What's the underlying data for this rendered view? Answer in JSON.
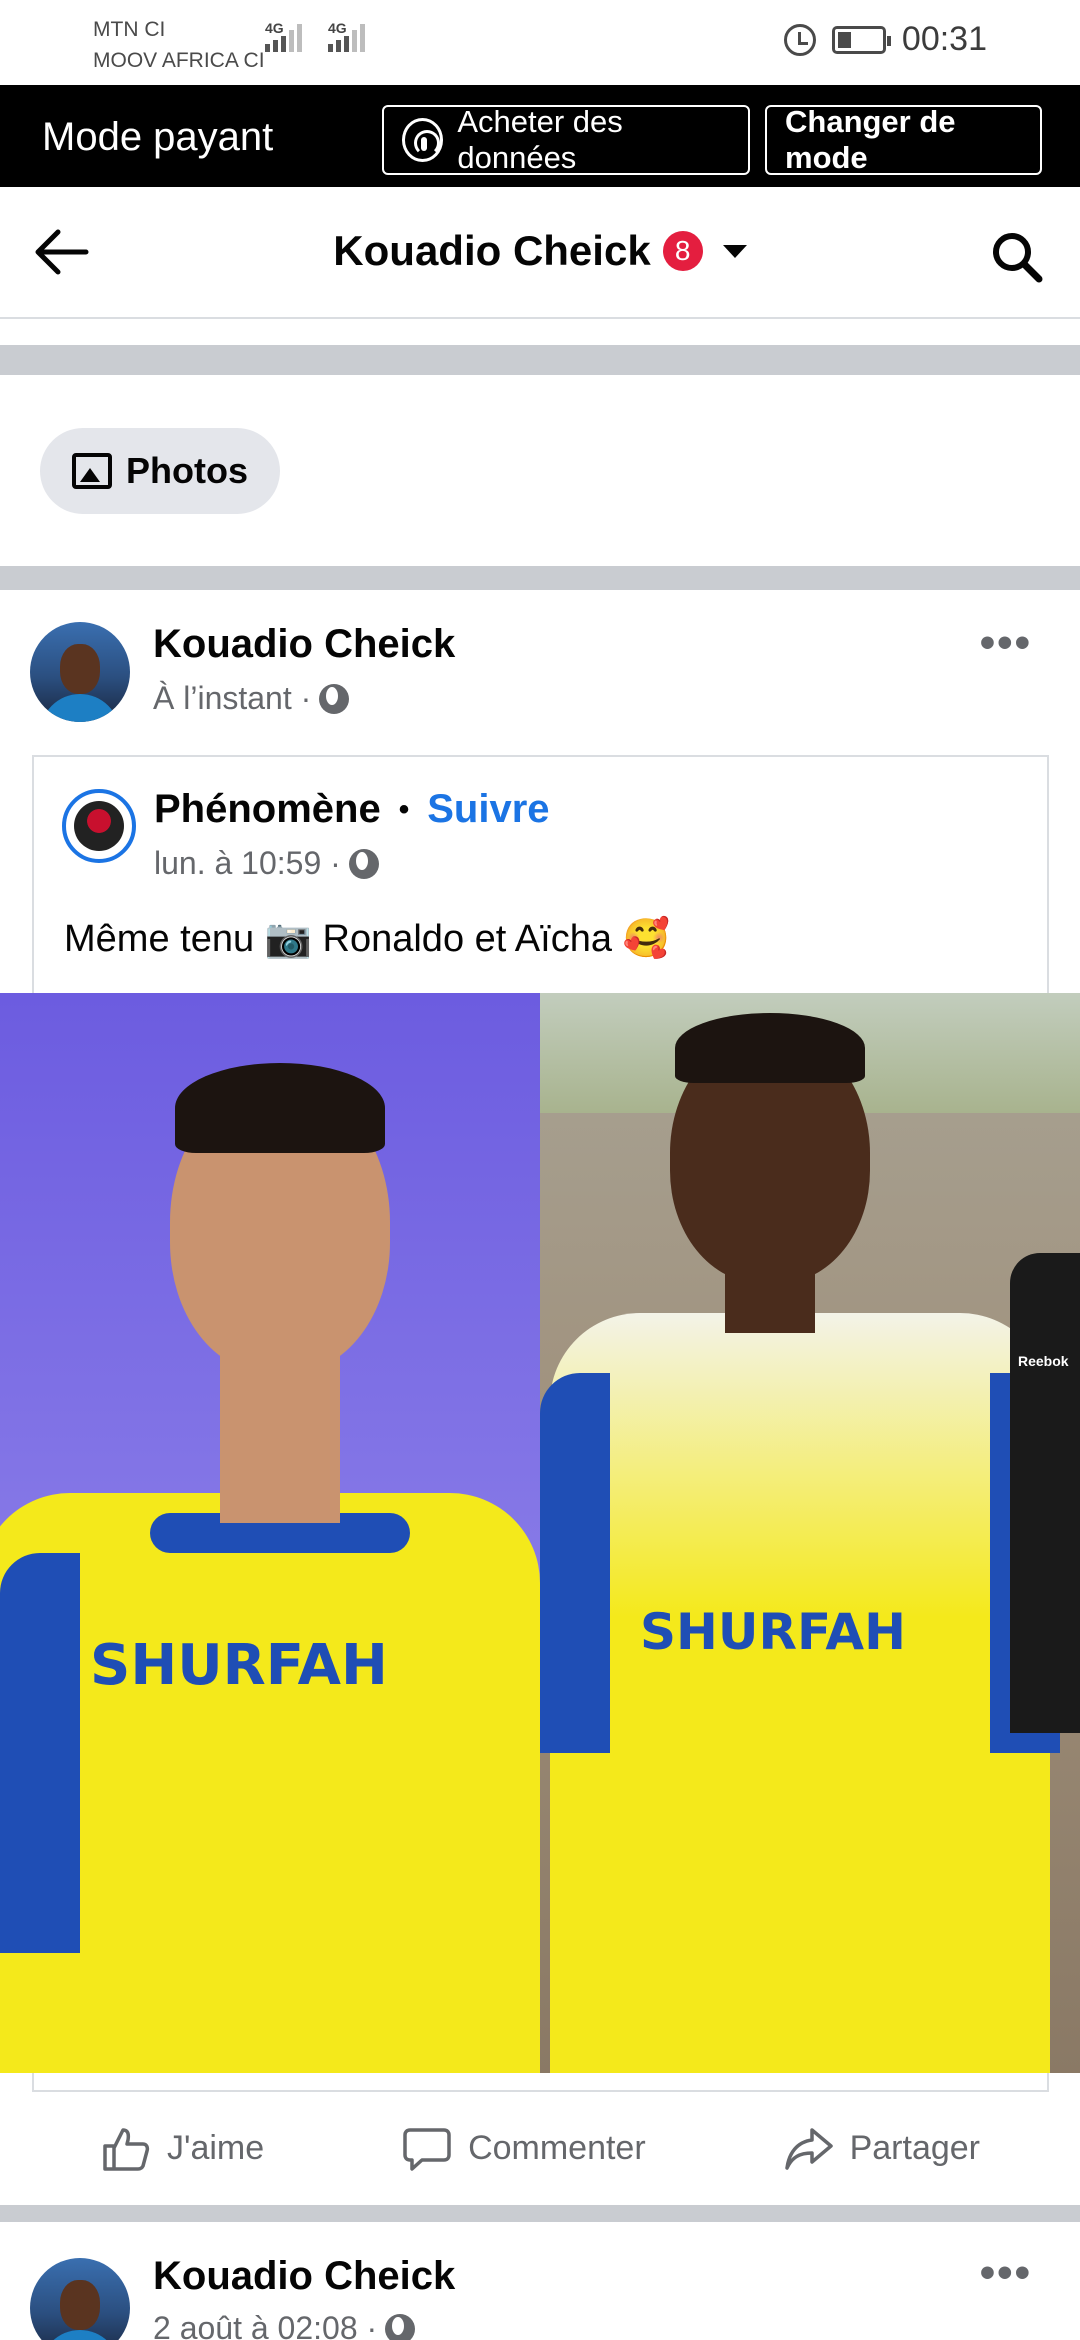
{
  "status_bar": {
    "carrier_1": "MTN CI",
    "carrier_2": "MOOV AFRICA CI",
    "network_1": "4G",
    "network_2": "4G",
    "time": "00:31"
  },
  "data_mode_bar": {
    "title": "Mode payant",
    "buy_data_label": "Acheter des données",
    "change_mode_label": "Changer de mode"
  },
  "header": {
    "title": "Kouadio Cheick",
    "notification_count": "8"
  },
  "photos_chip": {
    "label": "Photos"
  },
  "post": {
    "author": "Kouadio Cheick",
    "time": "À l’instant ·",
    "more_label": "•••",
    "shared": {
      "author": "Phénomène",
      "separator": "•",
      "follow_label": "Suivre",
      "time": "lun. à 10:59 ·",
      "text": "Même tenu 📷 Ronaldo et Aïcha 🥰"
    },
    "image": {
      "left_sponsor": "SHURFAH",
      "right_sponsor": "SHURFAH",
      "background_bottom_right_label": "Reebok"
    },
    "actions": {
      "like_label": "J'aime",
      "comment_label": "Commenter",
      "share_label": "Partager"
    }
  },
  "next_post": {
    "author": "Kouadio Cheick",
    "time": "2 août à 02:08 ·",
    "more_label": "•••"
  },
  "colors": {
    "accent": "#1b74e4",
    "badge": "#e41e3f",
    "jersey_yellow": "#f4e91b",
    "jersey_blue": "#1f4eb5"
  }
}
